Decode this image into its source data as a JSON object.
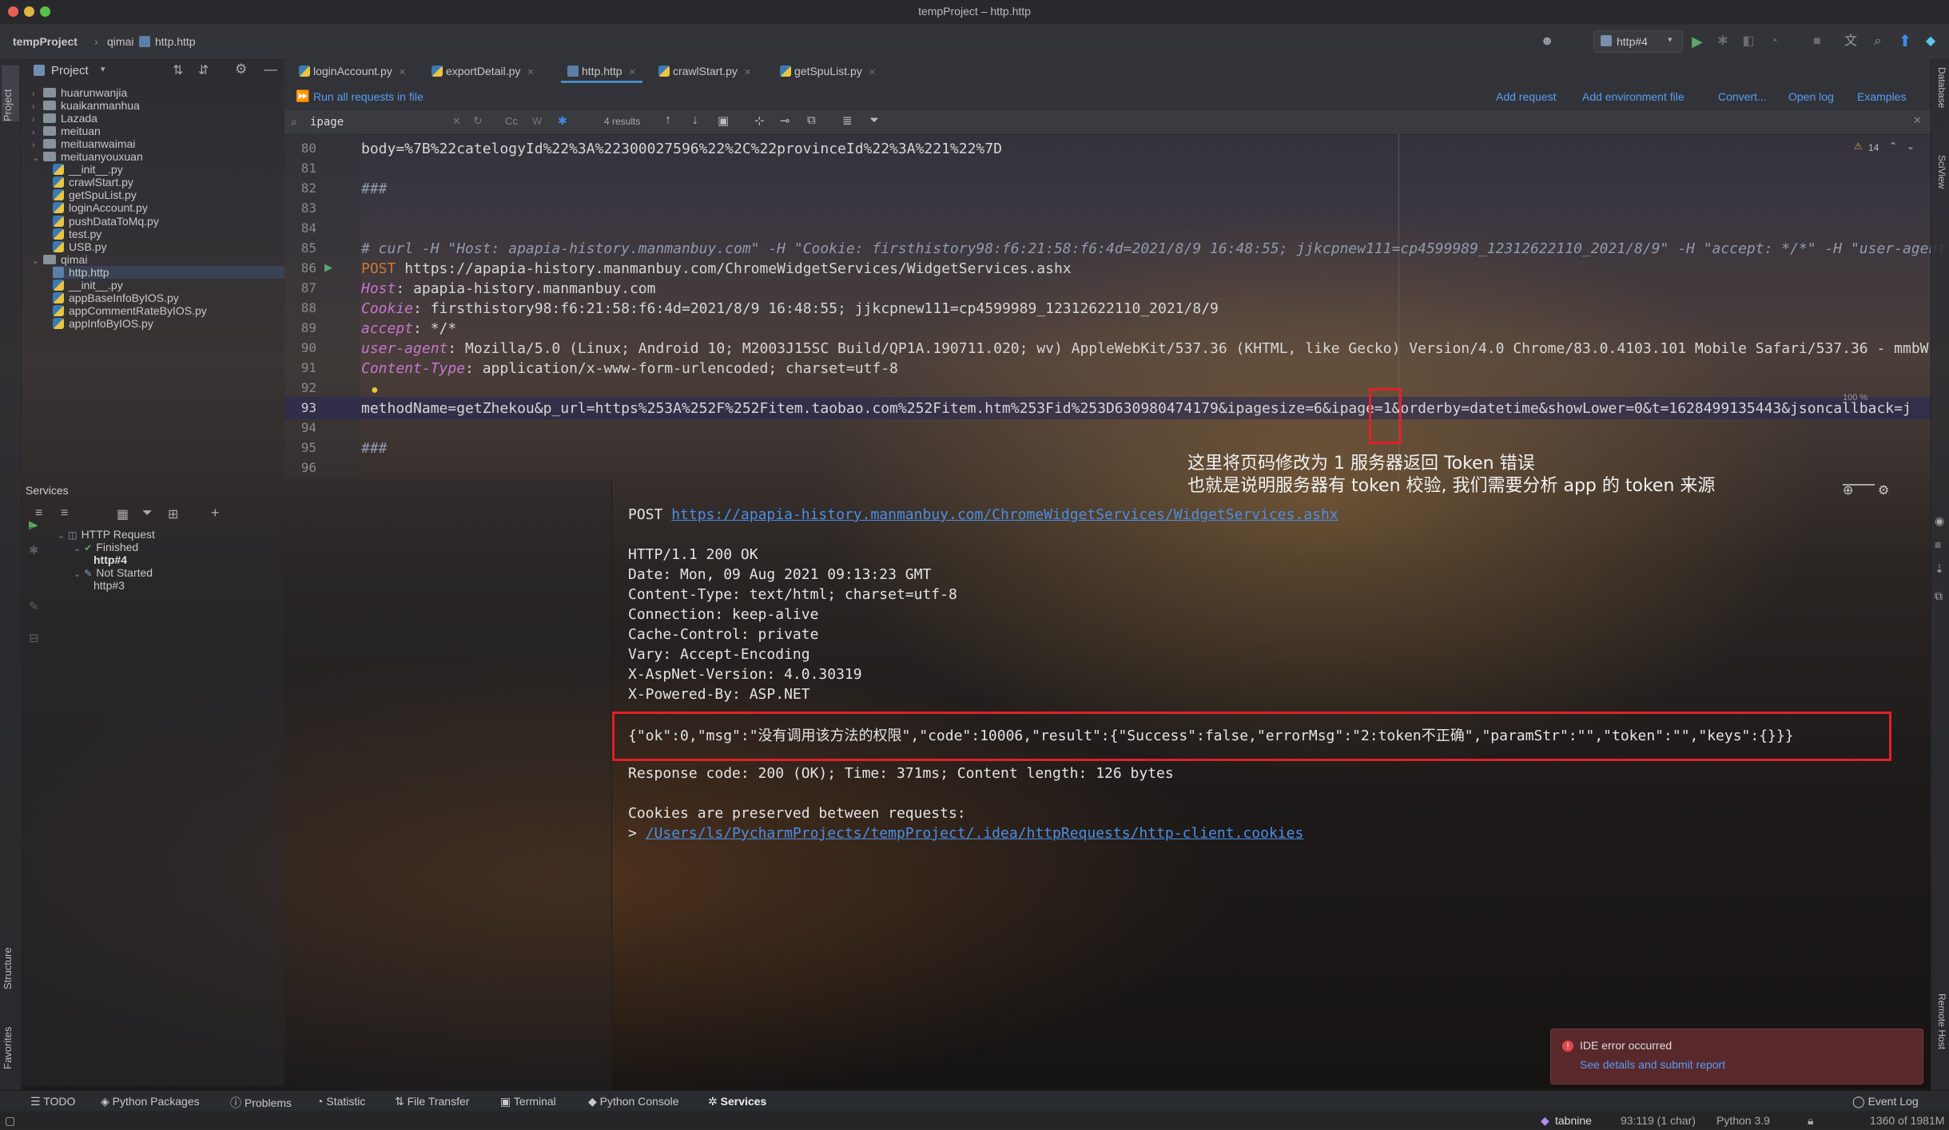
{
  "window": {
    "title": "tempProject – http.http"
  },
  "navbar": {
    "crumbs": [
      "tempProject",
      "qimai",
      "http.http"
    ],
    "run_config": "http#4"
  },
  "project": {
    "label": "Project",
    "tree": [
      {
        "label": "huarunwanjia",
        "type": "folder",
        "depth": 1,
        "expanded": false
      },
      {
        "label": "kuaikanmanhua",
        "type": "folder",
        "depth": 1,
        "expanded": false
      },
      {
        "label": "Lazada",
        "type": "folder",
        "depth": 1,
        "expanded": false
      },
      {
        "label": "meituan",
        "type": "folder",
        "depth": 1,
        "expanded": false
      },
      {
        "label": "meituanwaimai",
        "type": "folder",
        "depth": 1,
        "expanded": false
      },
      {
        "label": "meituanyouxuan",
        "type": "folder",
        "depth": 1,
        "expanded": true
      },
      {
        "label": "__init__.py",
        "type": "py",
        "depth": 2
      },
      {
        "label": "crawlStart.py",
        "type": "py",
        "depth": 2
      },
      {
        "label": "getSpuList.py",
        "type": "py",
        "depth": 2
      },
      {
        "label": "loginAccount.py",
        "type": "py",
        "depth": 2
      },
      {
        "label": "pushDataToMq.py",
        "type": "py",
        "depth": 2
      },
      {
        "label": "test.py",
        "type": "py",
        "depth": 2
      },
      {
        "label": "USB.py",
        "type": "py",
        "depth": 2
      },
      {
        "label": "qimai",
        "type": "folder",
        "depth": 1,
        "expanded": true
      },
      {
        "label": "http.http",
        "type": "http",
        "depth": 2
      },
      {
        "label": "__init__.py",
        "type": "py",
        "depth": 2
      },
      {
        "label": "appBaseInfoByIOS.py",
        "type": "py",
        "depth": 2
      },
      {
        "label": "appCommentRateByIOS.py",
        "type": "py",
        "depth": 2
      },
      {
        "label": "appInfoByIOS.py",
        "type": "py",
        "depth": 2
      }
    ]
  },
  "services": {
    "label": "Services",
    "tree": [
      {
        "label": "HTTP Request",
        "depth": 0
      },
      {
        "label": "Finished",
        "depth": 1
      },
      {
        "label": "http#4",
        "depth": 2
      },
      {
        "label": "Not Started",
        "depth": 1
      },
      {
        "label": "http#3",
        "depth": 2
      }
    ]
  },
  "tabs": [
    "loginAccount.py",
    "exportDetail.py",
    "http.http",
    "crawlStart.py",
    "getSpuList.py"
  ],
  "active_tab": "http.http",
  "httpbar": {
    "run_all": "Run all requests in file",
    "actions": [
      "Add request",
      "Add environment file",
      "Convert...",
      "Open log",
      "Examples"
    ]
  },
  "search": {
    "query": "ipage",
    "results": "4 results",
    "cc": "Cc",
    "w": "W"
  },
  "editor": {
    "warnings": "14",
    "zoom": "100 %",
    "lines": [
      {
        "n": "80",
        "text": "body=%7B%22catelogyId%22%3A%22300027596%22%2C%22provinceId%22%3A%221%22%7D"
      },
      {
        "n": "81",
        "text": ""
      },
      {
        "n": "82",
        "text": "###"
      },
      {
        "n": "83",
        "text": ""
      },
      {
        "n": "84",
        "text": ""
      },
      {
        "n": "85",
        "text": "# curl -H \"Host: apapia-history.manmanbuy.com\" -H \"Cookie: firsthistory98:f6:21:58:f6:4d=2021/8/9 16:48:55; jjkcpnew111=cp4599989_12312622110_2021/8/9\" -H \"accept: */*\" -H \"user-agent"
      },
      {
        "n": "86",
        "method": "POST",
        "text": " https://apapia-history.manmanbuy.com/ChromeWidgetServices/WidgetServices.ashx"
      },
      {
        "n": "87",
        "header": "Host",
        "text": ": apapia-history.manmanbuy.com"
      },
      {
        "n": "88",
        "header": "Cookie",
        "text": ": firsthistory98:f6:21:58:f6:4d=2021/8/9 16:48:55; jjkcpnew111=cp4599989_12312622110_2021/8/9"
      },
      {
        "n": "89",
        "header": "accept",
        "text": ": */*"
      },
      {
        "n": "90",
        "header": "user-agent",
        "text": ": Mozilla/5.0 (Linux; Android 10; M2003J15SC Build/QP1A.190711.020; wv) AppleWebKit/537.36 (KHTML, like Gecko) Version/4.0 Chrome/83.0.4103.101 Mobile Safari/537.36 - mmbW"
      },
      {
        "n": "91",
        "header": "Content-Type",
        "text": ": application/x-www-form-urlencoded; charset=utf-8"
      },
      {
        "n": "92",
        "text": ""
      },
      {
        "n": "93",
        "text": "methodName=getZhekou&p_url=https%253A%252F%252Fitem.taobao.com%252Fitem.htm%253Fid%253D630980474179&ipagesize=6&ipage=1&orderby=datetime&showLower=0&t=1628499135443&jsoncallback=j"
      },
      {
        "n": "94",
        "text": ""
      },
      {
        "n": "95",
        "text": "###"
      },
      {
        "n": "96",
        "text": ""
      }
    ]
  },
  "annotation": {
    "line1": "这里将页码修改为 1 服务器返回 Token 错误",
    "line2": "也就是说明服务器有 token 校验, 我们需要分析 app 的 token 来源"
  },
  "response": {
    "request_line_method": "POST",
    "request_url": "https://apapia-history.manmanbuy.com/ChromeWidgetServices/WidgetServices.ashx",
    "headers": [
      "HTTP/1.1 200 OK",
      "Date: Mon, 09 Aug 2021 09:13:23 GMT",
      "Content-Type: text/html; charset=utf-8",
      "Connection: keep-alive",
      "Cache-Control: private",
      "Vary: Accept-Encoding",
      "X-AspNet-Version: 4.0.30319",
      "X-Powered-By: ASP.NET"
    ],
    "body": "{\"ok\":0,\"msg\":\"没有调用该方法的权限\",\"code\":10006,\"result\":{\"Success\":false,\"errorMsg\":\"2:token不正确\",\"paramStr\":\"\",\"token\":\"\",\"keys\":{}}}",
    "summary": "Response code: 200 (OK); Time: 371ms; Content length: 126 bytes",
    "cookies_note": "Cookies are preserved between requests:",
    "cookies_prefix": "> ",
    "cookies_path": "/Users/ls/PycharmProjects/tempProject/.idea/httpRequests/http-client.cookies"
  },
  "notification": {
    "title": "IDE error occurred",
    "link": "See details and submit report"
  },
  "bottom_tools": [
    "TODO",
    "Python Packages",
    "Problems",
    "Statistic",
    "File Transfer",
    "Terminal",
    "Python Console",
    "Services"
  ],
  "event_log": "Event Log",
  "status": {
    "tabnine": "tabnine",
    "position": "93:119 (1 char)",
    "interpreter": "Python 3.9",
    "memory": "1360 of 1981M"
  },
  "left_stripe": [
    "Project",
    "Structure",
    "Favorites"
  ],
  "right_stripe": [
    "Database",
    "SciView",
    "Remote Host"
  ],
  "colors": {
    "accent": "#4a88c7",
    "link": "#589df6",
    "red_box": "#e0202a",
    "keyword": "#cc7832",
    "header": "#c577cf"
  }
}
